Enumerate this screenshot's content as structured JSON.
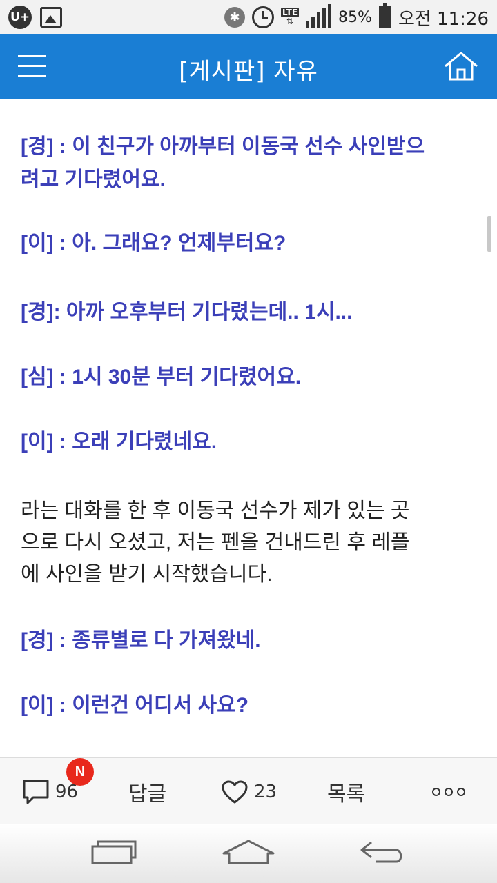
{
  "status_bar": {
    "carrier_logo": "U+",
    "battery_percent": "85%",
    "time": "오전 11:26",
    "network": "LTE",
    "icons": [
      "uplus-icon",
      "gallery-icon",
      "bluetooth-icon",
      "alarm-icon",
      "lte-icon",
      "signal-icon",
      "battery-icon"
    ]
  },
  "header": {
    "title": "[게시판] 자유",
    "menu_icon": "hamburger-menu-icon",
    "home_icon": "home-icon"
  },
  "post": {
    "lines": [
      {
        "style": "dialog",
        "text": "[경] : 이 친구가 아까부터 이동국 선수 사인받으"
      },
      {
        "style": "dialog",
        "text": "려고 기다렸어요."
      },
      {
        "style": "dialog",
        "text": "[이] : 아. 그래요? 언제부터요?"
      },
      {
        "style": "dialog",
        "text": "[경]: 아까 오후부터 기다렸는데.. 1시..."
      },
      {
        "style": "dialog",
        "text": "[심] : 1시 30분 부터 기다렸어요."
      },
      {
        "style": "dialog",
        "text": "[이] : 오래 기다렸네요."
      },
      {
        "style": "narr",
        "text": "라는 대화를 한 후 이동국 선수가 제가 있는 곳"
      },
      {
        "style": "narr",
        "text": "으로 다시 오셨고, 저는 펜을 건내드린 후 레플"
      },
      {
        "style": "narr",
        "text": "에 사인을 받기 시작했습니다."
      },
      {
        "style": "dialog",
        "text": "[경] : 종류별로 다 가져왔네."
      },
      {
        "style": "dialog",
        "text": "[이] : 이런건 어디서 사요?"
      }
    ]
  },
  "action_bar": {
    "comments_count": "96",
    "new_badge": "N",
    "reply_label": "답글",
    "likes_count": "23",
    "list_label": "목록"
  },
  "colors": {
    "header_bg": "#1a7ed4",
    "dialog_text": "#3b3fb8",
    "badge": "#e8281c"
  }
}
